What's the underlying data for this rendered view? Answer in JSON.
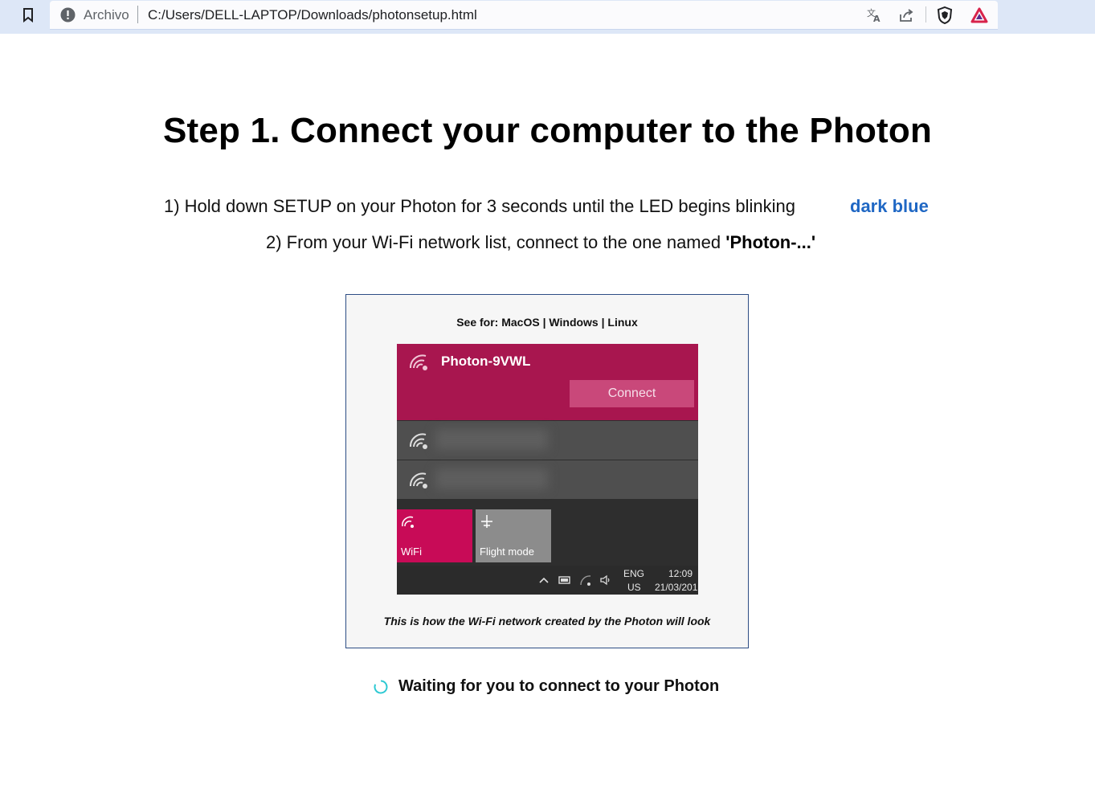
{
  "browser": {
    "scheme_label": "Archivo",
    "url": "C:/Users/DELL-LAPTOP/Downloads/photonsetup.html"
  },
  "page": {
    "title": "Step 1. Connect your computer to the Photon",
    "instruction1": "1) Hold down SETUP on your Photon for 3 seconds until the LED begins blinking",
    "led_color_label": "dark blue",
    "instruction2_prefix": "2) From your Wi-Fi network list, connect to the one named ",
    "instruction2_network": "'Photon-...'"
  },
  "preview": {
    "see_for_label": "See for:",
    "os_links": [
      "MacOS",
      "Windows",
      "Linux"
    ],
    "separator": "|",
    "network_name": "Photon-9VWL",
    "connect_label": "Connect",
    "tile_wifi": "WiFi",
    "tile_flight": "Flight mode",
    "taskbar_lang_top": "ENG",
    "taskbar_lang_bottom": "US",
    "taskbar_time": "12:09",
    "taskbar_date": "21/03/201",
    "caption": "This is how the Wi-Fi network created by the Photon will look"
  },
  "status": {
    "text": "Waiting for you to connect to your Photon"
  },
  "colors": {
    "accent_link": "#1f67c4",
    "spinner": "#2ec9d3",
    "selected_network": "#a8164f",
    "wifi_tile": "#c80b57"
  },
  "icons": [
    "bookmark-icon",
    "info-icon",
    "translate-icon",
    "share-icon",
    "brave-shield-icon",
    "brave-rewards-icon",
    "wifi-icon",
    "airplane-icon",
    "loading-spinner-icon"
  ]
}
